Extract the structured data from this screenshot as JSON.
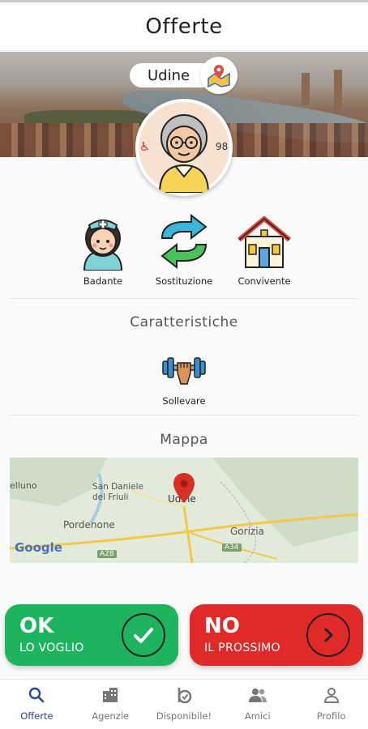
{
  "header": {
    "title": "Offerte"
  },
  "profile": {
    "city": "Udine",
    "age": "98",
    "icons": {
      "map": "map-pin-icon",
      "disability": "wheelchair-icon",
      "avatar": "elderly-woman-avatar"
    }
  },
  "roles": [
    {
      "label": "Badante",
      "icon": "nurse-icon"
    },
    {
      "label": "Sostituzione",
      "icon": "swap-arrows-icon"
    },
    {
      "label": "Convivente",
      "icon": "house-icon"
    }
  ],
  "features": {
    "title": "Caratteristiche",
    "items": [
      {
        "label": "Sollevare",
        "icon": "dumbbell-icon"
      }
    ]
  },
  "map": {
    "title": "Mappa",
    "labels": [
      "elluno",
      "San Daniele del Friuli",
      "Udine",
      "Pordenone",
      "Gorizia",
      "A28",
      "A34",
      "Google"
    ],
    "colors": {
      "land": "#dfe8d7",
      "road": "#f2c94c",
      "marker": "#d93025"
    }
  },
  "actions": {
    "ok": {
      "title": "OK",
      "subtitle": "LO VOGLIO",
      "color": "#1eb35f",
      "icon": "check-icon"
    },
    "no": {
      "title": "NO",
      "subtitle": "IL PROSSIMO",
      "color": "#e02a2a",
      "icon": "chevron-right-icon"
    }
  },
  "tabs": [
    {
      "label": "Offerte",
      "icon": "search-icon",
      "active": true
    },
    {
      "label": "Agenzie",
      "icon": "building-icon",
      "active": false
    },
    {
      "label": "Disponibile!",
      "icon": "badge-icon",
      "active": false
    },
    {
      "label": "Amici",
      "icon": "people-icon",
      "active": false
    },
    {
      "label": "Profilo",
      "icon": "person-icon",
      "active": false
    }
  ],
  "colors": {
    "accent": "#2a4a8a",
    "ok": "#1eb35f",
    "no": "#e02a2a"
  }
}
